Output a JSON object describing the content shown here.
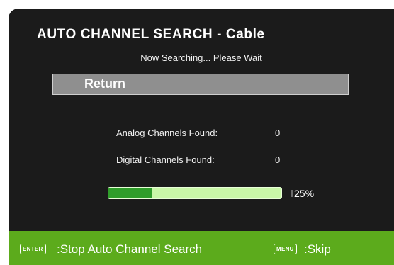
{
  "header": {
    "title": "AUTO CHANNEL SEARCH - Cable",
    "status": "Now Searching... Please Wait"
  },
  "menu": {
    "return_label": "Return"
  },
  "results": {
    "analog_label": "Analog Channels Found:",
    "analog_count": "0",
    "digital_label": "Digital Channels Found:",
    "digital_count": "0"
  },
  "progress": {
    "percent": 25,
    "percent_text": "25%"
  },
  "footer": {
    "enter_key": "ENTER",
    "enter_action": ":Stop Auto Channel Search",
    "menu_key": "MENU",
    "menu_action": ":Skip"
  },
  "colors": {
    "screen_bg": "#1b1b1b",
    "bar_bg": "#5cab1c",
    "progress_fill": "#2f9d2a",
    "progress_track": "#c9f7a8",
    "button_bg": "#8f8f8f"
  }
}
